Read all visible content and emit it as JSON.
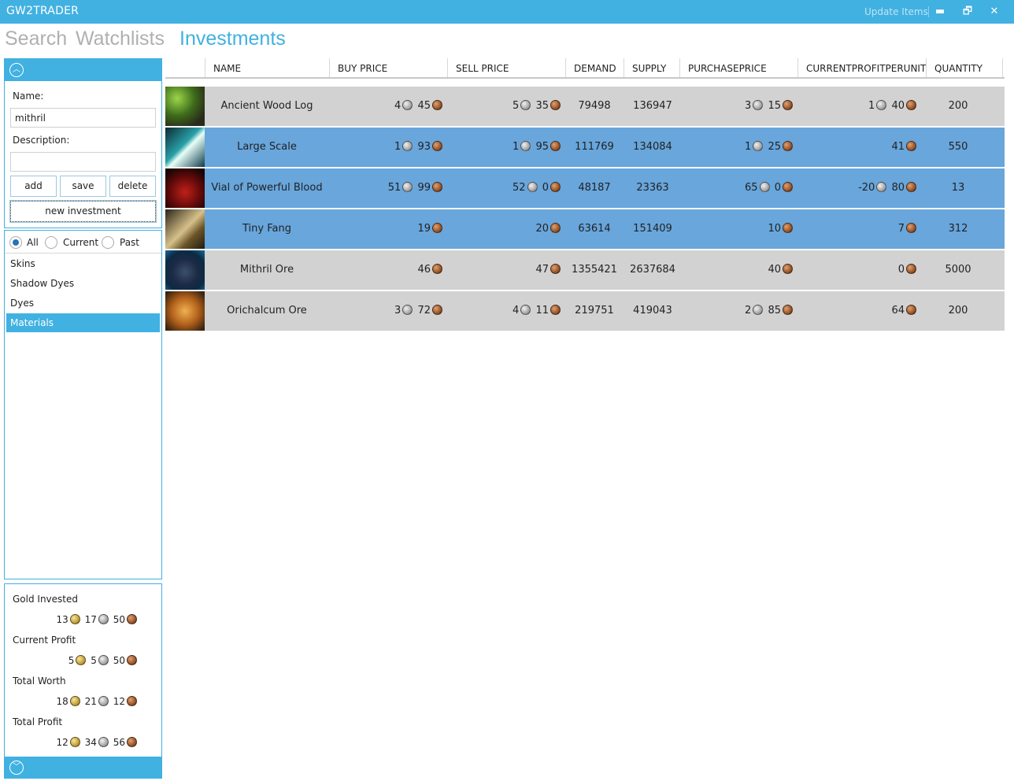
{
  "window": {
    "title": "GW2TRADER",
    "update_items": "Update Items",
    "minimize": "▬",
    "restore": "🗗",
    "close": "✕"
  },
  "nav": {
    "tabs": [
      {
        "label": "Search",
        "active": false
      },
      {
        "label": "Watchlists",
        "active": false
      },
      {
        "label": "Investments",
        "active": true
      }
    ]
  },
  "editor": {
    "name_label": "Name:",
    "name_value": "mithril",
    "description_label": "Description:",
    "description_value": "",
    "add_label": "add",
    "save_label": "save",
    "delete_label": "delete",
    "new_investment_label": "new investment"
  },
  "filter": {
    "options": [
      {
        "label": "All",
        "selected": true
      },
      {
        "label": "Current",
        "selected": false
      },
      {
        "label": "Past",
        "selected": false
      }
    ]
  },
  "categories": [
    {
      "label": "Skins",
      "selected": false
    },
    {
      "label": "Shadow Dyes",
      "selected": false
    },
    {
      "label": "Dyes",
      "selected": false
    },
    {
      "label": "Materials",
      "selected": true
    }
  ],
  "summary": [
    {
      "label": "Gold Invested",
      "gold": "13",
      "silver": "17",
      "copper": "50"
    },
    {
      "label": "Current Profit",
      "gold": "5",
      "silver": "5",
      "copper": "50"
    },
    {
      "label": "Total Worth",
      "gold": "18",
      "silver": "21",
      "copper": "12"
    },
    {
      "label": "Total Profit",
      "gold": "12",
      "silver": "34",
      "copper": "56"
    }
  ],
  "table": {
    "columns": [
      "NAME",
      "BUY PRICE",
      "SELL PRICE",
      "DEMAND",
      "SUPPLY",
      "PURCHASEPRICE",
      "CURRENTPROFITPERUNIT",
      "QUANTITY"
    ],
    "rows": [
      {
        "icon": "ancient-wood-log-icon",
        "name": "Ancient Wood Log",
        "buy": [
          "4",
          "45"
        ],
        "sell": [
          "5",
          "35"
        ],
        "demand": "79498",
        "supply": "136947",
        "purchase": [
          "3",
          "15"
        ],
        "profit": [
          "1",
          "40"
        ],
        "quantity": "200",
        "highlight": false
      },
      {
        "icon": "large-scale-icon",
        "name": "Large Scale",
        "buy": [
          "1",
          "93"
        ],
        "sell": [
          "1",
          "95"
        ],
        "demand": "111769",
        "supply": "134084",
        "purchase": [
          "1",
          "25"
        ],
        "profit": [
          "",
          "41"
        ],
        "quantity": "550",
        "highlight": true
      },
      {
        "icon": "vial-of-powerful-blood-icon",
        "name": "Vial of Powerful Blood",
        "buy": [
          "51",
          "99"
        ],
        "sell": [
          "52",
          "0"
        ],
        "demand": "48187",
        "supply": "23363",
        "purchase": [
          "65",
          "0"
        ],
        "profit": [
          "-20",
          "80"
        ],
        "quantity": "13",
        "highlight": true
      },
      {
        "icon": "tiny-fang-icon",
        "name": "Tiny Fang",
        "buy": [
          "",
          "19"
        ],
        "sell": [
          "",
          "20"
        ],
        "demand": "63614",
        "supply": "151409",
        "purchase": [
          "",
          "10"
        ],
        "profit": [
          "",
          "7"
        ],
        "quantity": "312",
        "highlight": true
      },
      {
        "icon": "mithril-ore-icon",
        "name": "Mithril Ore",
        "buy": [
          "",
          "46"
        ],
        "sell": [
          "",
          "47"
        ],
        "demand": "1355421",
        "supply": "2637684",
        "purchase": [
          "",
          "40"
        ],
        "profit": [
          "",
          "0"
        ],
        "quantity": "5000",
        "highlight": false
      },
      {
        "icon": "orichalcum-ore-icon",
        "name": "Orichalcum Ore",
        "buy": [
          "3",
          "72"
        ],
        "sell": [
          "4",
          "11"
        ],
        "demand": "219751",
        "supply": "419043",
        "purchase": [
          "2",
          "85"
        ],
        "profit": [
          "",
          "64"
        ],
        "quantity": "200",
        "highlight": false
      }
    ]
  },
  "colors": {
    "accent": "#41b1e1",
    "row_highlight": "#68a6dc",
    "row_normal": "#d2d2d2"
  }
}
